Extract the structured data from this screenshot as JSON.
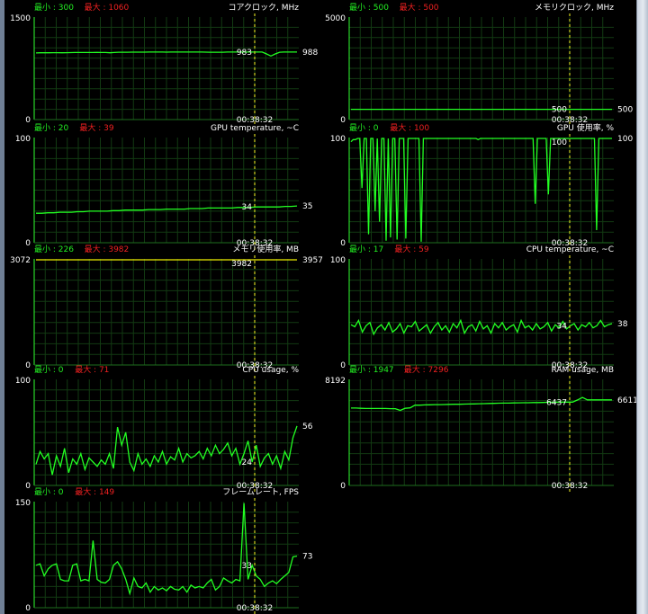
{
  "window": {
    "time": "00:38:32"
  },
  "graphs": [
    {
      "id": "core-clock",
      "title": "コアクロック, MHz",
      "min_label": "最小 : 300",
      "max_label": "最大 : 1060",
      "ymax_label": "1500",
      "ymin_label": "0",
      "current": "988",
      "cursor_value": "983",
      "ymax": 1500,
      "data": [
        975,
        977,
        978,
        978,
        979,
        979,
        978,
        979,
        980,
        981,
        981,
        982,
        982,
        982,
        983,
        982,
        981,
        978,
        982,
        985,
        986,
        986,
        987,
        987,
        987,
        987,
        988,
        988,
        988,
        988,
        987,
        988,
        988,
        988,
        988,
        988,
        988,
        988,
        988,
        987,
        986,
        986,
        986,
        986,
        988,
        988,
        988,
        988,
        988,
        988,
        988,
        988,
        988,
        960,
        930,
        960,
        985,
        988,
        988,
        988,
        988
      ]
    },
    {
      "id": "mem-clock",
      "title": "メモリクロック, MHz",
      "min_label": "最小 : 500",
      "max_label": "最大 : 500",
      "ymax_label": "5000",
      "ymin_label": "0",
      "current": "500",
      "cursor_value": "500",
      "ymax": 5000,
      "data": [
        500,
        500,
        500,
        500,
        500,
        500,
        500,
        500,
        500,
        500,
        500,
        500,
        500,
        500,
        500,
        500,
        500,
        500,
        500,
        500
      ]
    },
    {
      "id": "gpu-temp",
      "title": "GPU temperature, ~C",
      "min_label": "最小 : 20",
      "max_label": "最大 : 39",
      "ymax_label": "100",
      "ymin_label": "0",
      "current": "35",
      "cursor_value": "34",
      "ymax": 100,
      "data": [
        28,
        28,
        28.5,
        28.5,
        29,
        29,
        29,
        29.5,
        29.5,
        30,
        30,
        30,
        30,
        30.5,
        30.5,
        31,
        31,
        31,
        31,
        31.5,
        31.5,
        31.5,
        32,
        32,
        32,
        32,
        32.5,
        32.5,
        32.5,
        33,
        33,
        33,
        33,
        33,
        33.5,
        33.5,
        33.5,
        34,
        34,
        34,
        34,
        34,
        34.5,
        34.5,
        35
      ]
    },
    {
      "id": "gpu-usage",
      "title": "GPU 使用率, %",
      "min_label": "最小 : 0",
      "max_label": "最大 : 100",
      "ymax_label": "100",
      "ymin_label": "0",
      "current": "100",
      "cursor_value": "100",
      "ymax": 100,
      "data": [
        96,
        98,
        98,
        100,
        100,
        52,
        100,
        100,
        8,
        100,
        100,
        30,
        100,
        20,
        100,
        100,
        2,
        100,
        5,
        100,
        100,
        3,
        100,
        100,
        100,
        4,
        100,
        100,
        100,
        100,
        100,
        100,
        1,
        100,
        100,
        100,
        100,
        100,
        100,
        100,
        100,
        100,
        100,
        100,
        100,
        100,
        100,
        100,
        100,
        100,
        100,
        100,
        100,
        100,
        100,
        100,
        100,
        100,
        98,
        100,
        100,
        100,
        100,
        100,
        100,
        100,
        100,
        100,
        100,
        100,
        100,
        100,
        100,
        100,
        100,
        100,
        100,
        100,
        100,
        100,
        100,
        100,
        100,
        100,
        37,
        100,
        100,
        100,
        100,
        100,
        46,
        100,
        100,
        100,
        100,
        100,
        100,
        100,
        100,
        100,
        100,
        100,
        100,
        100,
        100,
        100,
        100,
        100,
        100,
        100,
        100,
        100,
        12,
        100,
        100,
        100,
        100,
        100,
        100,
        100
      ]
    },
    {
      "id": "mem-usage",
      "title": "メモリ使用率, MB",
      "min_label": "最小 : 226",
      "max_label": "最大 : 3982",
      "ymax_label": "3072",
      "ymin_label": "0",
      "current": "3957",
      "cursor_value": "3982",
      "ymax": 3072,
      "data": [
        3957,
        3957,
        3957,
        3957,
        3957,
        3957,
        3957,
        3957,
        3957,
        3957,
        3957,
        3957,
        3957,
        3957,
        3957,
        3957,
        3957,
        3957,
        3957,
        3957
      ]
    },
    {
      "id": "cpu-temp",
      "title": "CPU temperature, ~C",
      "min_label": "最小 : 17",
      "max_label": "最大 : 59",
      "ymax_label": "100",
      "ymin_label": "0",
      "current": "38",
      "cursor_value": "34",
      "ymax": 100,
      "data": [
        38,
        36,
        42,
        31,
        37,
        40,
        29,
        35,
        38,
        33,
        40,
        31,
        34,
        39,
        30,
        37,
        36,
        41,
        32,
        35,
        38,
        30,
        36,
        40,
        33,
        37,
        31,
        39,
        35,
        42,
        30,
        36,
        38,
        32,
        41,
        34,
        37,
        30,
        39,
        35,
        40,
        33,
        36,
        38,
        31,
        42,
        35,
        37,
        33,
        39,
        34,
        36,
        40,
        32,
        38,
        35,
        41,
        34,
        37,
        39,
        33,
        38,
        36,
        40,
        35,
        37,
        42,
        36,
        38,
        39
      ]
    },
    {
      "id": "cpu-usage",
      "title": "CPU usage, %",
      "min_label": "最小 : 0",
      "max_label": "最大 : 71",
      "ymax_label": "100",
      "ymin_label": "0",
      "current": "56",
      "cursor_value": "24",
      "ymax": 100,
      "data": [
        20,
        32,
        25,
        30,
        10,
        28,
        18,
        35,
        12,
        25,
        20,
        30,
        15,
        26,
        22,
        18,
        24,
        20,
        30,
        16,
        55,
        38,
        50,
        22,
        14,
        30,
        20,
        25,
        18,
        28,
        22,
        32,
        20,
        27,
        24,
        35,
        22,
        30,
        26,
        28,
        32,
        25,
        35,
        28,
        38,
        30,
        34,
        40,
        28,
        35,
        20,
        30,
        42,
        22,
        38,
        18,
        26,
        30,
        20,
        28,
        16,
        32,
        24,
        45,
        56
      ]
    },
    {
      "id": "ram-usage",
      "title": "RAM usage, MB",
      "min_label": "最小 : 1947",
      "max_label": "最大 : 7296",
      "ymax_label": "8192",
      "ymin_label": "0",
      "current": "6611",
      "cursor_value": "6437",
      "ymax": 8192,
      "data": [
        5980,
        5980,
        5960,
        5940,
        5940,
        5940,
        5940,
        5940,
        5930,
        5930,
        5800,
        5960,
        5990,
        6200,
        6200,
        6220,
        6230,
        6240,
        6240,
        6250,
        6260,
        6270,
        6270,
        6280,
        6290,
        6300,
        6310,
        6320,
        6330,
        6340,
        6350,
        6360,
        6360,
        6370,
        6380,
        6390,
        6390,
        6400,
        6400,
        6410,
        6420,
        6430,
        6437,
        6437,
        6437,
        6437,
        6600,
        6800,
        6611,
        6611,
        6611,
        6611,
        6611,
        6611
      ]
    },
    {
      "id": "framerate",
      "title": "フレームレート, FPS",
      "min_label": "最小 : 0",
      "max_label": "最大 : 149",
      "ymax_label": "150",
      "ymin_label": "0",
      "current": "73",
      "cursor_value": "33",
      "ymax": 150,
      "data": [
        60,
        62,
        45,
        55,
        60,
        62,
        40,
        38,
        38,
        60,
        62,
        38,
        40,
        38,
        95,
        40,
        36,
        35,
        40,
        60,
        65,
        55,
        40,
        20,
        42,
        30,
        28,
        35,
        22,
        30,
        25,
        28,
        24,
        30,
        26,
        25,
        30,
        22,
        32,
        28,
        30,
        28,
        35,
        40,
        25,
        30,
        42,
        38,
        35,
        40,
        38,
        148,
        40,
        60,
        45,
        40,
        30,
        35,
        38,
        34,
        40,
        45,
        50,
        72,
        73
      ]
    }
  ],
  "colors": {
    "grid": "#123a12",
    "gridfine": "#0b210b",
    "axis": "#30ff30",
    "line": "#22ff22",
    "yellow": "#f0f000",
    "min": "#22ee22",
    "max": "#ee2020",
    "cursor": "#d0d020"
  }
}
